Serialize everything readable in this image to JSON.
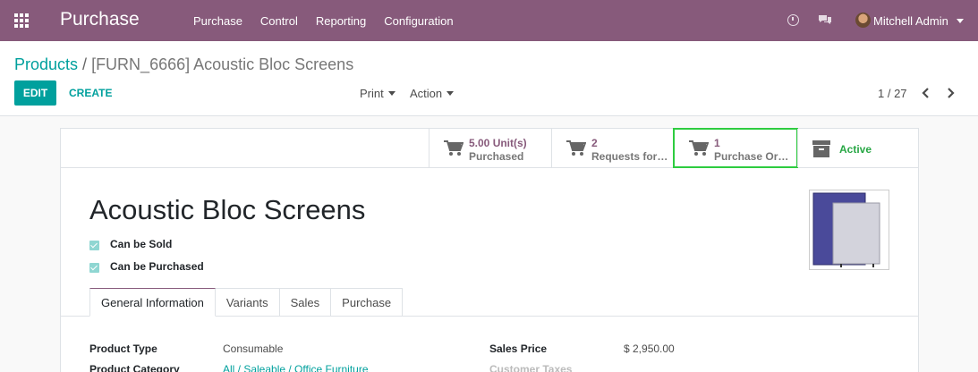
{
  "navbar": {
    "brand": "Purchase",
    "menu": [
      "Purchase",
      "Control",
      "Reporting",
      "Configuration"
    ],
    "user_name": "Mitchell Admin",
    "icons": [
      "apps-grid-icon",
      "clock-icon",
      "chat-icon",
      "chevron-down-icon"
    ],
    "color": "#875a7b"
  },
  "breadcrumb": {
    "parent": "Products",
    "separator": "/",
    "current": "[FURN_6666] Acoustic Bloc Screens"
  },
  "toolbar": {
    "edit_label": "EDIT",
    "create_label": "CREATE",
    "print_label": "Print",
    "action_label": "Action"
  },
  "pager": {
    "value": "1 / 27"
  },
  "smart_buttons": [
    {
      "value": "5.00 Unit(s)",
      "label": "Purchased",
      "icon": "cart-icon"
    },
    {
      "value": "2",
      "label": "Requests for…",
      "icon": "cart-icon"
    },
    {
      "value": "1",
      "label": "Purchase Or…",
      "icon": "cart-icon"
    },
    {
      "value": "",
      "label": "Active",
      "icon": "archive-icon"
    }
  ],
  "product": {
    "name": "Acoustic Bloc Screens",
    "can_be_sold": "Can be Sold",
    "can_be_purchased": "Can be Purchased"
  },
  "tabs": [
    "General Information",
    "Variants",
    "Sales",
    "Purchase"
  ],
  "fields": {
    "product_type_label": "Product Type",
    "product_type_value": "Consumable",
    "product_category_label": "Product Category",
    "product_category_value": "All / Saleable / Office Furniture",
    "sales_price_label": "Sales Price",
    "sales_price_value": "$ 2,950.00",
    "customer_taxes_label": "Customer Taxes"
  },
  "colors": {
    "accent": "#00a09d",
    "brand": "#875a7b",
    "active": "#28a745",
    "highlight": "#2ecc40"
  }
}
